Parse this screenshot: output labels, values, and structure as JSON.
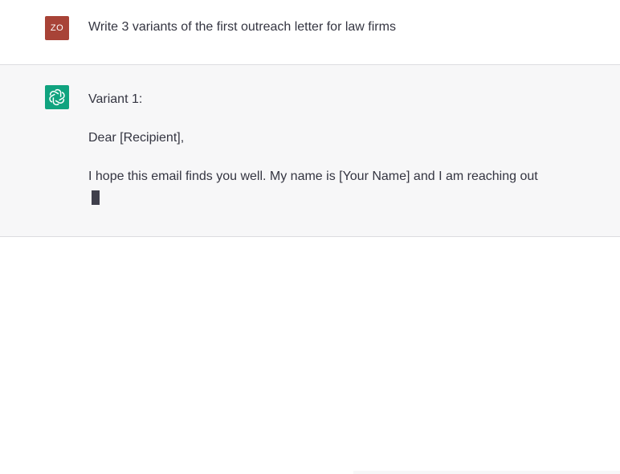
{
  "user_message": {
    "avatar_initials": "ZO",
    "text": "Write 3 variants of the first outreach letter for law firms"
  },
  "assistant_message": {
    "avatar_icon": "openai-logo-icon",
    "lines": [
      "Variant 1:",
      "Dear [Recipient],",
      "I hope this email finds you well. My name is [Your Name] and I am reaching out"
    ]
  },
  "colors": {
    "user_avatar": "#a84337",
    "assistant_avatar": "#10a37f",
    "assistant_bg": "#f7f7f8",
    "text": "#343541"
  }
}
